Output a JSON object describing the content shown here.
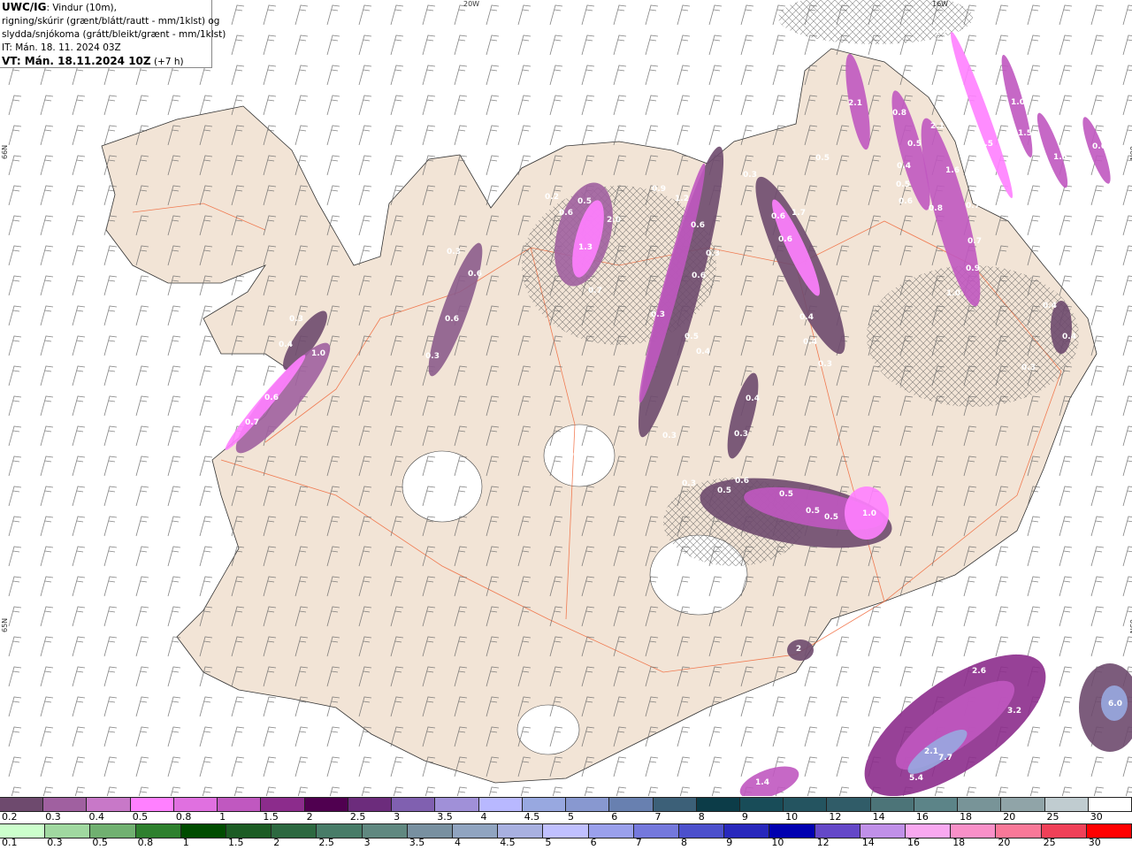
{
  "title": {
    "model": "UWC/IG",
    "line1": ": Vindur (10m),",
    "line2": "rigning/skúrir (grænt/blátt/rautt - mm/1klst) og",
    "line3": "slydda/snjókoma (grátt/bleikt/grænt - mm/1klst)",
    "init_time": "IT: Mán. 18. 11. 2024 03Z",
    "valid_time": "VT: Mán. 18.11.2024 10Z",
    "lead": " (+7 h)"
  },
  "grid_labels": {
    "lon_20w": "20W",
    "lon_16w": "16W",
    "lat_66n": "66N",
    "lat_65n": "65N"
  },
  "colors": {
    "land": "#f2e4d6",
    "roads": "#f06030",
    "background": "#ffffff",
    "barbs": "#555555"
  },
  "map_values": [
    "0.3",
    "0.4",
    "1.0",
    "0.6",
    "0.7",
    "0.3",
    "0.6",
    "0.6",
    "0.3",
    "0.2",
    "0.6",
    "0.5",
    "2.0",
    "1.3",
    "0.7",
    "0.9",
    "1.2",
    "0.6",
    "0.3",
    "0.6",
    "0.3",
    "0.5",
    "0.4",
    "0.3",
    "0.4",
    "0.3",
    "0.3",
    "0.3",
    "0.5",
    "0.6",
    "0.5",
    "0.5",
    "0.5",
    "1.0",
    "0.3",
    "0.6",
    "1.7",
    "0.6",
    "0.4",
    "0.4",
    "0.3",
    "2.1",
    "0.5",
    "0.8",
    "0.5",
    "0.4",
    "0.5",
    "0.6",
    "2.1",
    "1.6",
    "0.8",
    "0.7",
    "0.7",
    "0.9",
    "1.0",
    "1.0",
    "1.0",
    "0.5",
    "0.5",
    "1.5",
    "1.5",
    "0.6",
    "0.6",
    "0.4",
    "0.4",
    "0.4",
    "0.3",
    "1.5",
    "2.6",
    "3.2",
    "6.0",
    "2.1",
    "7.7",
    "1.9",
    "5.4",
    "1.4",
    "0.3",
    "2"
  ],
  "legend_snow": {
    "labels": [
      "0.2",
      "0.3",
      "0.4",
      "0.5",
      "0.8",
      "1",
      "1.5",
      "2",
      "2.5",
      "3",
      "3.5",
      "4",
      "4.5",
      "5",
      "6",
      "7",
      "8",
      "9",
      "10",
      "12",
      "14",
      "16",
      "18",
      "20",
      "25",
      "30"
    ],
    "colors": [
      "#6e4a6e",
      "#a060a0",
      "#c878c8",
      "#ff80ff",
      "#e070e0",
      "#c058c0",
      "#8c2c8c",
      "#500050",
      "#6c2c7c",
      "#8060b0",
      "#a090d8",
      "#b8b8ff",
      "#98a8e0",
      "#8898d0",
      "#6880b0",
      "#3c6078",
      "#0c3c48",
      "#184c58",
      "#245460",
      "#305c68",
      "#4c7478",
      "#5c8488",
      "#789498",
      "#90a4a8",
      "#c0ccd0",
      "#ffffff"
    ]
  },
  "legend_rain": {
    "labels": [
      "0.1",
      "0.3",
      "0.5",
      "0.8",
      "1",
      "1.5",
      "2",
      "2.5",
      "3",
      "3.5",
      "4",
      "4.5",
      "5",
      "6",
      "7",
      "8",
      "9",
      "10",
      "12",
      "14",
      "16",
      "18",
      "20",
      "25",
      "30"
    ],
    "colors": [
      "#ccffcc",
      "#a0d8a0",
      "#70b070",
      "#2e802e",
      "#004c00",
      "#1c5c24",
      "#2c6840",
      "#487c68",
      "#608880",
      "#7890a0",
      "#90a4c0",
      "#a8b0e0",
      "#c0c0ff",
      "#9aa0ec",
      "#7478dc",
      "#4c50cc",
      "#2828bc",
      "#0000b0",
      "#6448c8",
      "#c090e8",
      "#f8a8f0",
      "#f890c8",
      "#f87898",
      "#f04058",
      "#ff0000"
    ]
  }
}
